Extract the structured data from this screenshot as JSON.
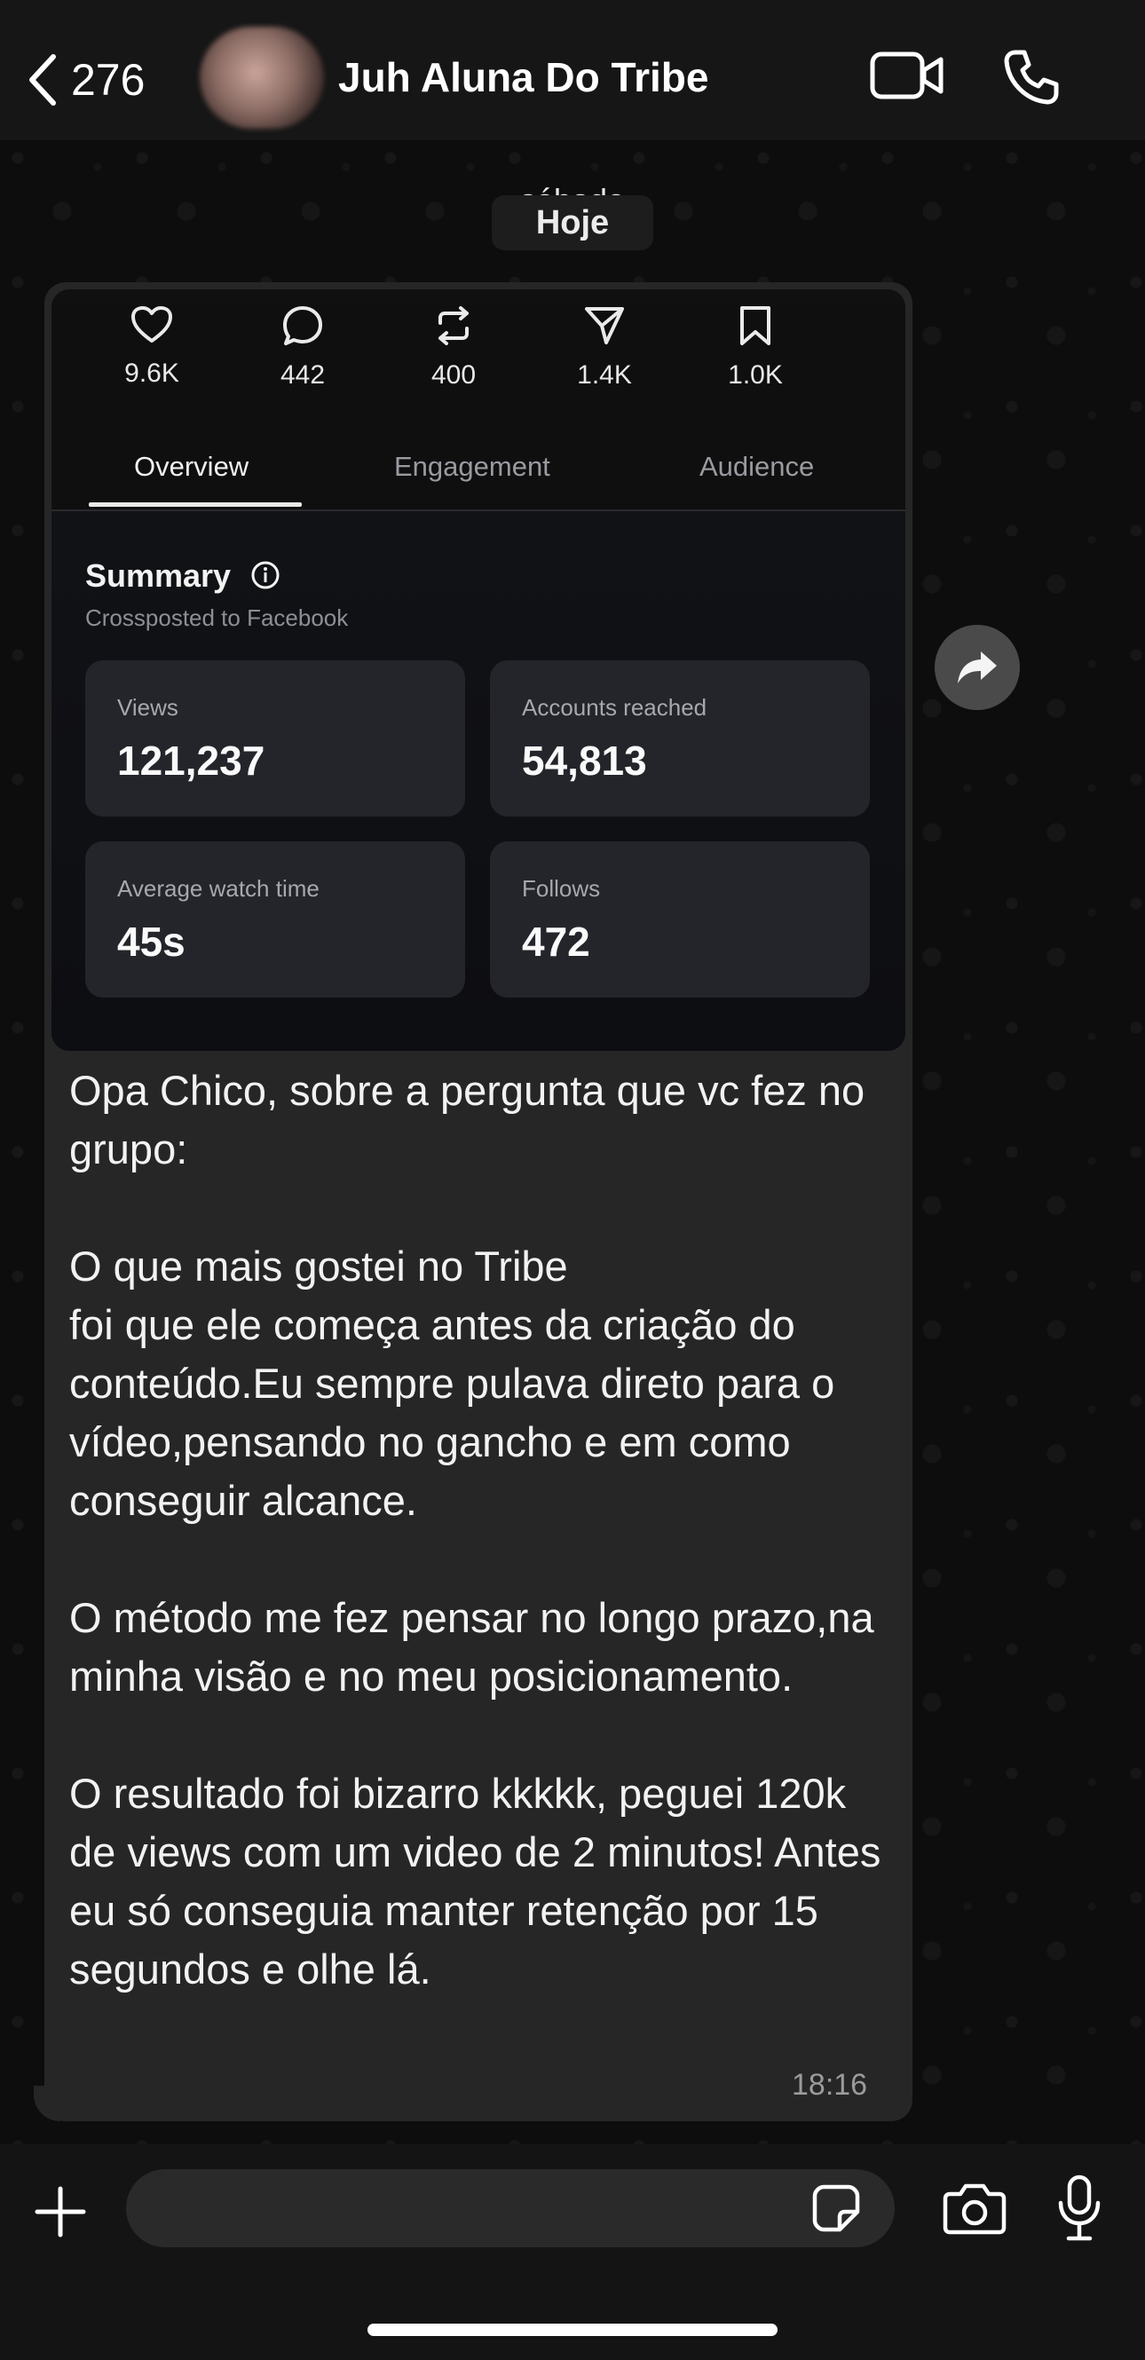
{
  "header": {
    "back_count": "276",
    "contact_name": "Juh Aluna Do Tribe",
    "icons": [
      "back-chevron-icon",
      "video-call-icon",
      "phone-icon"
    ]
  },
  "date_chips": {
    "previous": "sábado",
    "current": "Hoje"
  },
  "insights": {
    "stats": [
      {
        "icon": "heart-icon",
        "value": "9.6K"
      },
      {
        "icon": "comment-icon",
        "value": "442"
      },
      {
        "icon": "repost-icon",
        "value": "400"
      },
      {
        "icon": "share-icon",
        "value": "1.4K"
      },
      {
        "icon": "bookmark-icon",
        "value": "1.0K"
      }
    ],
    "tabs": [
      "Overview",
      "Engagement",
      "Audience"
    ],
    "active_tab": "Overview",
    "summary_title": "Summary",
    "summary_subtitle": "Crossposted to Facebook",
    "cards": [
      {
        "label": "Views",
        "value": "121,237"
      },
      {
        "label": "Accounts reached",
        "value": "54,813"
      },
      {
        "label": "Average watch time",
        "value": "45s"
      },
      {
        "label": "Follows",
        "value": "472"
      }
    ]
  },
  "message": {
    "text": "Opa Chico, sobre a pergunta que vc fez no grupo:\n\nO que mais gostei no Tribe\nfoi que ele começa antes da criação do conteúdo.Eu sempre pulava direto para o vídeo,pensando no gancho e em como conseguir alcance.\n\nO método me fez pensar no longo prazo,na minha visão e no meu posicionamento.\n\nO resultado foi bizarro kkkkk, peguei 120k de views com um video de 2 minutos! Antes eu só conseguia manter retenção por 15 segundos e olhe lá.",
    "time": "18:16"
  },
  "composer": {
    "placeholder": "",
    "icons": [
      "plus-icon",
      "sticker-icon",
      "camera-icon",
      "microphone-icon"
    ]
  },
  "colors": {
    "background": "#0b0b0b",
    "bubble": "#262626",
    "card": "#23252b",
    "text": "#f2f2f2"
  }
}
